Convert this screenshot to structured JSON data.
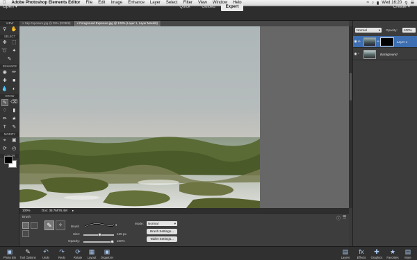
{
  "menubar": {
    "apple": "",
    "app_name": "Adobe Photoshop Elements Editor",
    "items": [
      "File",
      "Edit",
      "Image",
      "Enhance",
      "Layer",
      "Select",
      "Filter",
      "View",
      "Window",
      "Help"
    ],
    "clock": "Wed 16:20"
  },
  "modebar": {
    "open_label": "Open",
    "modes": [
      "Quick",
      "Guided",
      "Expert"
    ],
    "create_label": "Create"
  },
  "toolbar": {
    "sections": [
      "VIEW",
      "SELECT",
      "ENHANCE",
      "DRAW",
      "MODIFY",
      "COLOR"
    ]
  },
  "tabs": [
    {
      "label": "Sky Exposure.jpg @ 25% (RGB/8)"
    },
    {
      "label": "Foreground Exposure.jpg @ 100% (Layer 1, Layer Mask/8)"
    }
  ],
  "status": {
    "zoom": "100%",
    "doc": "Doc: 35.7M/76.4M"
  },
  "tool_options": {
    "title": "Brush",
    "brush_label": "Brush",
    "size_label": "Size:",
    "size_value": "125 px",
    "size_fraction": 0.55,
    "opacity_label": "Opacity:",
    "opacity_value": "100%",
    "opacity_fraction": 1.0,
    "mode_label": "Mode:",
    "mode_value": "Normal",
    "brush_settings": "Brush Settings...",
    "tablet_settings": "Tablet Settings..."
  },
  "layers_panel": {
    "blend_mode": "Normal",
    "opacity_label": "Opacity:",
    "opacity_value": "100%",
    "layers": [
      {
        "name": "Layer 1",
        "selected": true
      },
      {
        "name": "Background",
        "selected": false
      }
    ]
  },
  "bottombar": {
    "left": [
      "Photo Bin",
      "Tool Options",
      "Undo",
      "Redo",
      "Rotate",
      "Layout",
      "Organizer"
    ],
    "right": [
      "Layers",
      "Effects",
      "Graphics",
      "Favorites",
      "More"
    ]
  }
}
